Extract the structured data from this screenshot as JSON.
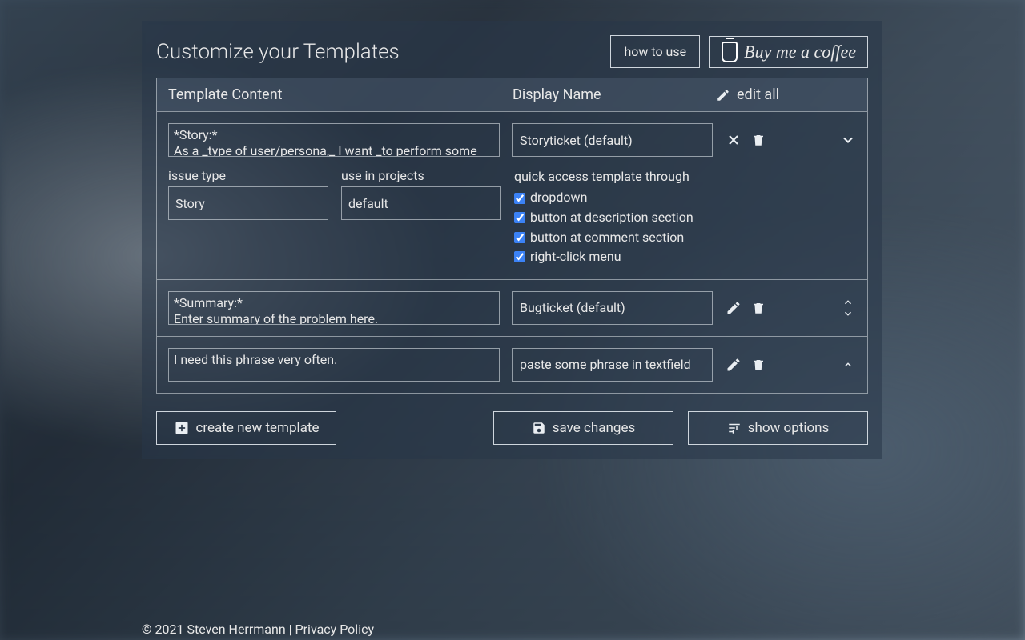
{
  "header": {
    "title": "Customize your Templates",
    "how_to_use": "how to use",
    "buy_me_a_coffee": "Buy me a coffee"
  },
  "table_head": {
    "col1": "Template Content",
    "col2": "Display Name",
    "edit_all": "edit all"
  },
  "templates": [
    {
      "content": "*Story:*\nAs a _type of user/persona,_ I want _to perform some",
      "display_name": "Storyticket (default)",
      "expanded": true,
      "fields": {
        "issue_type_label": "issue type",
        "issue_type_value": "Story",
        "projects_label": "use in projects",
        "projects_value": "default",
        "quick_access_label": "quick access template through",
        "options": {
          "dropdown": {
            "label": "dropdown",
            "checked": true
          },
          "button_description": {
            "label": "button at description section",
            "checked": true
          },
          "button_comment": {
            "label": "button at comment section",
            "checked": true
          },
          "right_click": {
            "label": "right-click menu",
            "checked": true
          }
        }
      }
    },
    {
      "content": "*Summary:*\nEnter summary of the problem here.",
      "display_name": "Bugticket (default)",
      "expanded": false
    },
    {
      "content": "I need this phrase very often.",
      "display_name": "paste some phrase in textfield",
      "expanded": false
    }
  ],
  "footer_buttons": {
    "create": "create new template",
    "save": "save changes",
    "options": "show options"
  },
  "page_footer": {
    "copyright": "© 2021 Steven Herrmann | ",
    "privacy": "Privacy Policy"
  }
}
